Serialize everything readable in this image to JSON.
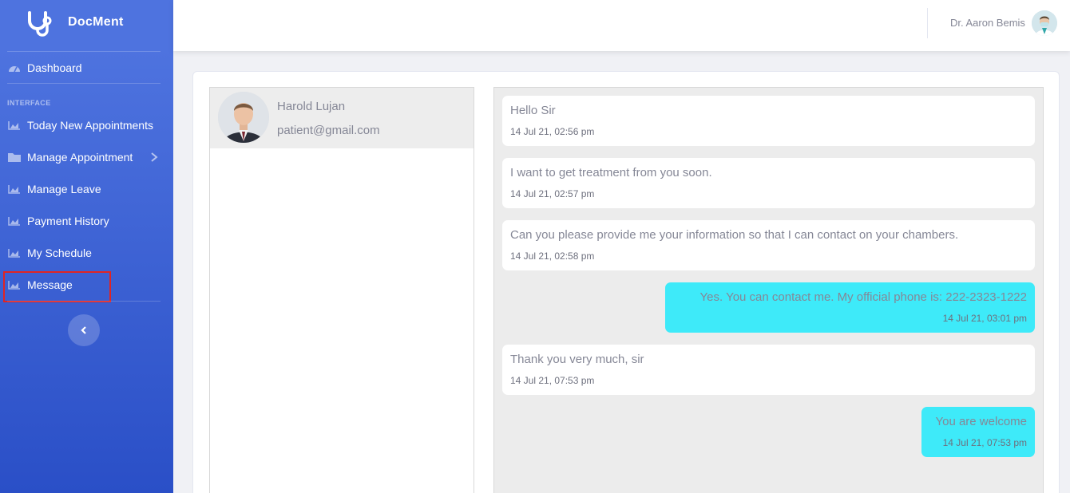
{
  "brand": {
    "name": "DocMent",
    "icon": "stethoscope-icon"
  },
  "sidebar": {
    "dashboard": {
      "label": "Dashboard",
      "icon": "tachometer-icon"
    },
    "section_heading": "INTERFACE",
    "items": [
      {
        "label": "Today New Appointments",
        "icon": "chart-area-icon"
      },
      {
        "label": "Manage Appointment",
        "icon": "folder-icon",
        "has_submenu": true
      },
      {
        "label": "Manage Leave",
        "icon": "chart-area-icon"
      },
      {
        "label": "Payment History",
        "icon": "chart-area-icon"
      },
      {
        "label": "My Schedule",
        "icon": "chart-area-icon"
      },
      {
        "label": "Message",
        "icon": "chart-area-icon",
        "highlighted": true
      }
    ],
    "toggle_icon": "chevron-left-icon"
  },
  "topbar": {
    "user_name": "Dr. Aaron Bemis"
  },
  "contacts": [
    {
      "name": "Harold Lujan",
      "email": "patient@gmail.com"
    }
  ],
  "messages": [
    {
      "direction": "in",
      "text": "Hello Sir",
      "time": "14 Jul 21, 02:56 pm"
    },
    {
      "direction": "in",
      "text": "I want to get treatment from you soon.",
      "time": "14 Jul 21, 02:57 pm"
    },
    {
      "direction": "in",
      "text": "Can you please provide me your information so that I can contact on your chambers.",
      "time": "14 Jul 21, 02:58 pm"
    },
    {
      "direction": "out",
      "text": "Yes. You can contact me. My official phone is: 222-2323-1222",
      "time": "14 Jul 21, 03:01 pm"
    },
    {
      "direction": "in",
      "text": "Thank you very much, sir",
      "time": "14 Jul 21, 07:53 pm"
    },
    {
      "direction": "out",
      "text": "You are welcome",
      "time": "14 Jul 21, 07:53 pm"
    }
  ],
  "colors": {
    "sidebar_top": "#4e73df",
    "sidebar_bottom": "#2a4fc7",
    "outgoing_bubble": "#3eeaf9",
    "highlight": "#e02424"
  }
}
